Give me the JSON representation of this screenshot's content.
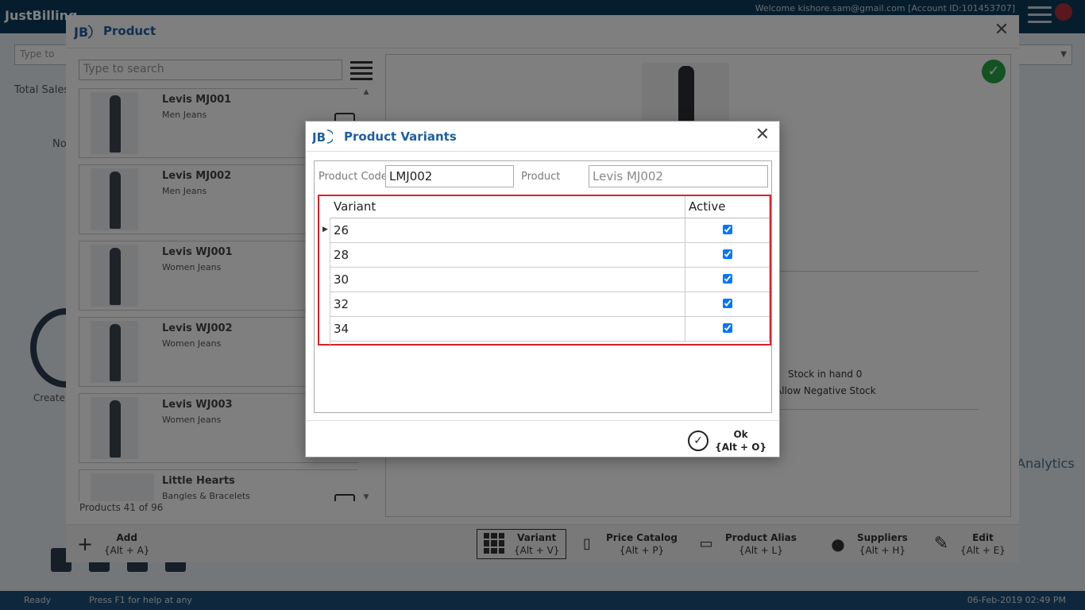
{
  "app": {
    "logo_text": "JustBilling",
    "welcome": "Welcome kishore.sam@gmail.com [Account ID:101453707]"
  },
  "background": {
    "search_placeholder": "Type to",
    "total_sales": "Total Sales",
    "no_label": "No",
    "create_label": "Create",
    "analytics": "Analytics",
    "status_ready": "Ready",
    "status_help": "Press F1 for help at any",
    "status_date": "06-Feb-2019 02:49 PM"
  },
  "product_window": {
    "title": "Product",
    "close_label": "✕",
    "search_placeholder": "Type to search",
    "products": [
      {
        "name": "Levis MJ001",
        "category": "Men Jeans"
      },
      {
        "name": "Levis MJ002",
        "category": "Men Jeans"
      },
      {
        "name": "Levis WJ001",
        "category": "Women Jeans"
      },
      {
        "name": "Levis WJ002",
        "category": "Women Jeans"
      },
      {
        "name": "Levis WJ003",
        "category": "Women Jeans"
      },
      {
        "name": "Little Hearts",
        "category": "Bangles & Bracelets"
      }
    ],
    "count_text": "Products 41 of 96",
    "stock_in_hand": "Stock in hand 0",
    "allow_negative": "Allow Negative Stock",
    "toolbar": [
      {
        "label": "Add",
        "shortcut": "{Alt + A}",
        "icon": "plus-icon"
      },
      {
        "label": "Variant",
        "shortcut": "{Alt + V}",
        "icon": "grid-icon"
      },
      {
        "label": "Price Catalog",
        "shortcut": "{Alt + P}",
        "icon": "catalog-icon"
      },
      {
        "label": "Product Alias",
        "shortcut": "{Alt + L}",
        "icon": "tag-icon"
      },
      {
        "label": "Suppliers",
        "shortcut": "{Alt + H}",
        "icon": "supplier-icon"
      },
      {
        "label": "Edit",
        "shortcut": "{Alt + E}",
        "icon": "pencil-icon"
      }
    ]
  },
  "dialog": {
    "title": "Product Variants",
    "close_label": "✕",
    "product_code_label": "Product Code",
    "product_code_value": "LMJ002",
    "product_label": "Product",
    "product_value": "Levis MJ002",
    "columns": {
      "variant": "Variant",
      "active": "Active"
    },
    "rows": [
      {
        "variant": "26",
        "active": true
      },
      {
        "variant": "28",
        "active": true
      },
      {
        "variant": "30",
        "active": true
      },
      {
        "variant": "32",
        "active": true
      },
      {
        "variant": "34",
        "active": true
      }
    ],
    "ok_label": "Ok",
    "ok_shortcut": "{Alt + O}",
    "accent_color": "#1f5f9e",
    "highlight_color": "#d8222b"
  }
}
